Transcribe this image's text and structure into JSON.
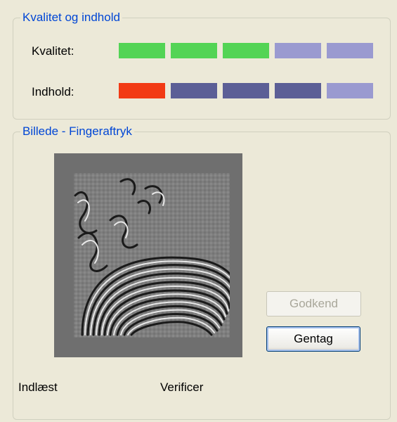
{
  "quality_group": {
    "title": "Kvalitet og indhold",
    "quality_label": "Kvalitet:",
    "content_label": "Indhold:",
    "quality_segments": [
      "#53d455",
      "#53d455",
      "#53d455",
      "#9a9ad0",
      "#9a9ad0"
    ],
    "content_segments": [
      "#f23a14",
      "#5c5f96",
      "#5c5f96",
      "#5c5f96",
      "#9a9ad0"
    ]
  },
  "image_group": {
    "title": "Billede - Fingeraftryk",
    "approve_button": "Godkend",
    "repeat_button": "Gentag",
    "status_loaded": "Indlæst",
    "status_verify": "Verificer"
  }
}
